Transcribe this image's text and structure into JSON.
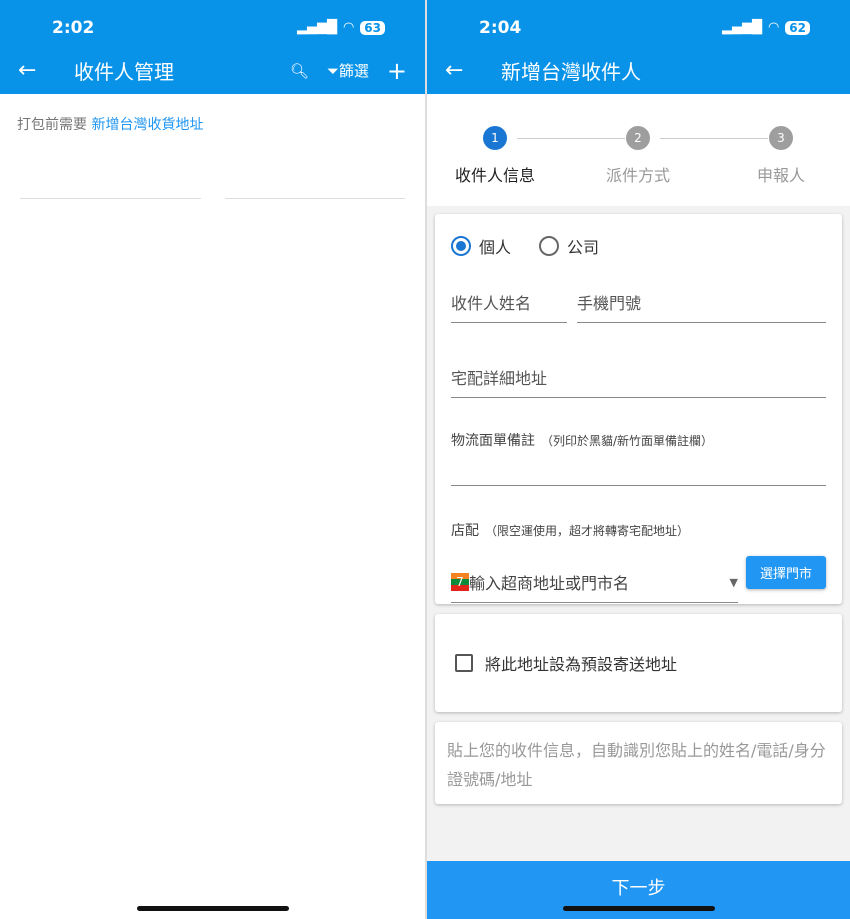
{
  "left": {
    "time": "2:02",
    "battery": "63",
    "title": "收件人管理",
    "filter_label": "篩選",
    "hint": "打包前需要",
    "hint_link": "新增台灣收貨地址"
  },
  "right": {
    "time": "2:04",
    "battery": "62",
    "title": "新增台灣收件人",
    "steps": [
      {
        "num": "1",
        "label": "收件人信息"
      },
      {
        "num": "2",
        "label": "派件方式"
      },
      {
        "num": "3",
        "label": "申報人"
      }
    ],
    "type_personal": "個人",
    "type_company": "公司",
    "name_placeholder": "收件人姓名",
    "phone_placeholder": "手機門號",
    "address_placeholder": "宅配詳細地址",
    "note_label": "物流面單備註",
    "note_sub": "（列印於黑貓/新竹面單備註欄）",
    "store_label": "店配",
    "store_sub": "（限空運使用，超才將轉寄宅配地址）",
    "store_placeholder": "輸入超商地址或門市名",
    "store_button": "選擇門市",
    "default_checkbox": "將此地址設為預設寄送地址",
    "paste_placeholder": "貼上您的收件信息，自動識別您貼上的姓名/電話/身分證號碼/地址",
    "next_button": "下一步"
  }
}
